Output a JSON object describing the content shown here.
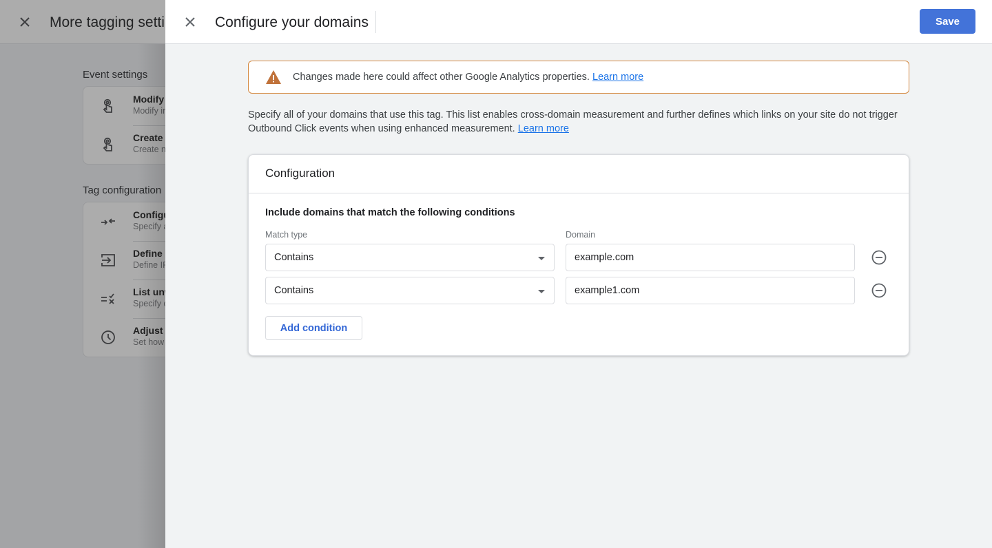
{
  "background": {
    "title": "More tagging setti",
    "sections": [
      {
        "label": "Event settings",
        "items": [
          {
            "icon": "touch-icon",
            "title": "Modify",
            "subtitle": "Modify ir"
          },
          {
            "icon": "touch-icon",
            "title": "Create e",
            "subtitle": "Create ne"
          }
        ]
      },
      {
        "label": "Tag configuration",
        "items": [
          {
            "icon": "merge-arrows-icon",
            "title": "Configu",
            "subtitle": "Specify a"
          },
          {
            "icon": "input-arrow-icon",
            "title": "Define i",
            "subtitle": "Define IP"
          },
          {
            "icon": "rule-list-icon",
            "title": "List unw",
            "subtitle": "Specify c"
          },
          {
            "icon": "clock-icon",
            "title": "Adjust s",
            "subtitle": "Set how"
          }
        ]
      }
    ]
  },
  "drawer": {
    "title": "Configure your domains",
    "save_label": "Save",
    "warning": {
      "icon": "warning-triangle-icon",
      "text": "Changes made here could affect other Google Analytics properties.",
      "link": "Learn more",
      "color": "#c0723a"
    },
    "description": {
      "text": "Specify all of your domains that use this tag. This list enables cross-domain measurement and further defines which links on your site do not trigger Outbound Click events when using enhanced measurement.",
      "link": "Learn more"
    },
    "card": {
      "title": "Configuration",
      "heading": "Include domains that match the following conditions",
      "match_type_label": "Match type",
      "domain_label": "Domain",
      "conditions": [
        {
          "match_type": "Contains",
          "domain": "example.com"
        },
        {
          "match_type": "Contains",
          "domain": "example1.com"
        }
      ],
      "add_label": "Add condition"
    },
    "accent_color": "#4373d9"
  }
}
